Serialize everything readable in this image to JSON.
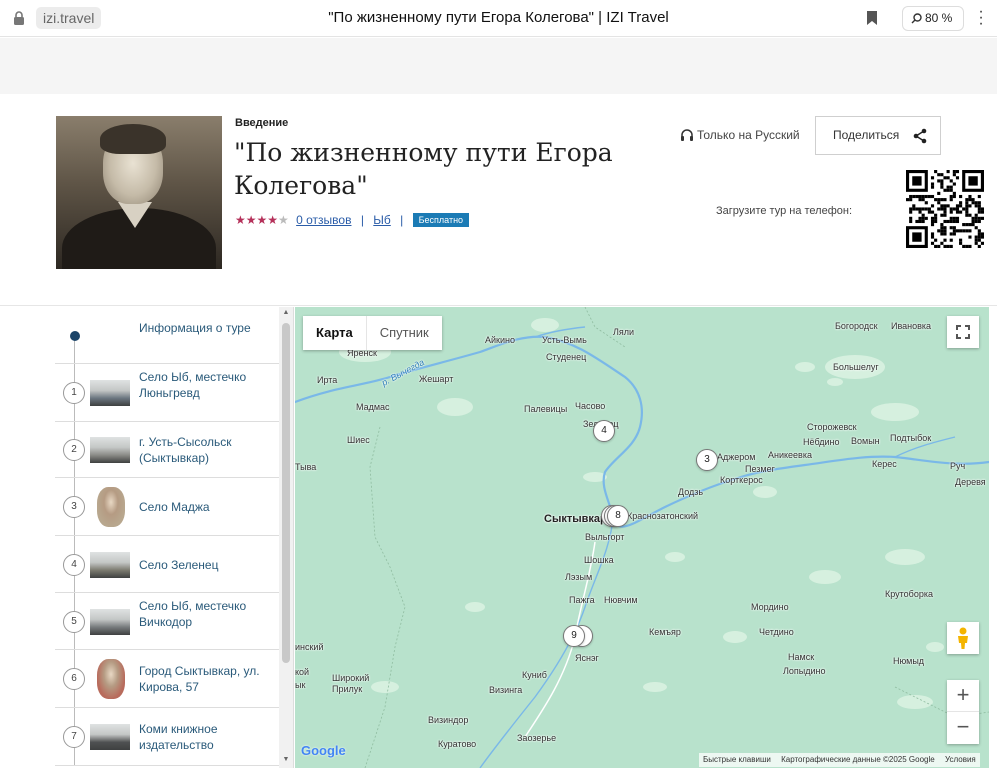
{
  "browser": {
    "domain": "izi.travel",
    "page_title": "\"По жизненному пути Егора Колегова\" | IZI Travel",
    "zoom": "80 %"
  },
  "tour": {
    "section_label": "Введение",
    "title": "\"По жизненному пути Егора Колегова\"",
    "rating": 4,
    "rating_max": 5,
    "reviews_link": "0 отзывов",
    "separator": "|",
    "location_link": "Ыб",
    "price_badge": "Бесплатно",
    "language": "Только на Русский",
    "share_label": "Поделиться",
    "download_label": "Загрузите тур на телефон:"
  },
  "colors": {
    "accent": "#1b7bb5",
    "stars": "#b5315a",
    "link": "#2a5ca8",
    "map_bg": "#b8e2cc",
    "river": "#7ab8e8"
  },
  "stops": [
    {
      "num": "",
      "label": "Информация о туре",
      "icon": "info-dot"
    },
    {
      "num": "1",
      "label": "Село Ыб, местечко Люньгревд",
      "icon": "photo-thumb"
    },
    {
      "num": "2",
      "label": "г. Усть-Сысольск (Сыктывкар)",
      "icon": "photo-thumb"
    },
    {
      "num": "3",
      "label": "Село Маджа",
      "icon": "portrait-thumb"
    },
    {
      "num": "4",
      "label": "Село Зеленец",
      "icon": "photo-thumb"
    },
    {
      "num": "5",
      "label": "Село Ыб, местечко Вичкодор",
      "icon": "photo-thumb"
    },
    {
      "num": "6",
      "label": "Город Сыктывкар, ул. Кирова, 57",
      "icon": "portrait-thumb"
    },
    {
      "num": "7",
      "label": "Коми книжное издательство",
      "icon": "photo-thumb"
    }
  ],
  "map": {
    "type_map": "Карта",
    "type_satellite": "Спутник",
    "zoom_in": "+",
    "zoom_out": "−",
    "google": "Google",
    "attrib_shortcuts": "Быстрые клавиши",
    "attrib_data": "Картографические данные ©2025 Google",
    "attrib_terms": "Условия",
    "places": {
      "ainio": "Айкино",
      "ustvym": "Усть-Вымь",
      "lyali": "Ляли",
      "studenets": "Студенец",
      "yarensk": "Яренск",
      "irta": "Ирта",
      "zheshart": "Жешарт",
      "madmas": "Мадмас",
      "chasovo": "Часово",
      "palevitsy": "Палевицы",
      "zelenets": "Зеленец",
      "shies": "Шиес",
      "tyva": "Тыва",
      "adzherom": "Аджером",
      "anikeevka": "Аникеевка",
      "pezmeg": "Пезмег",
      "korkeros": "Корткерос",
      "dodz": "Додзь",
      "syktyvkar": "Сыктывкар",
      "vylgort": "Выльгорт",
      "krasnozatonsky": "Краснозатонский",
      "shoshka": "Шошка",
      "lyzym": "Лэзым",
      "pazhga": "Пажга",
      "nyuvchim": "Нювчим",
      "kemyar": "Кемъяр",
      "yasnag": "Яснэг",
      "kunib": "Куниб",
      "vizinga": "Визинга",
      "vizindor": "Визиндор",
      "zaozerye": "Заозерье",
      "kuratovo": "Куратово",
      "shirokiy": "Широкий Прилук",
      "bogorodsk": "Богородск",
      "ivanovka": "Ивановка",
      "bolshelug": "Большелуг",
      "storozhevsk": "Сторожевск",
      "nebdino": "Нёбдино",
      "vomyn": "Вомын",
      "podtybok": "Подтыбок",
      "keres": "Керес",
      "ruch": "Руч",
      "derevya": "Деревя",
      "krutoborka": "Крутоборка",
      "mordino": "Мордино",
      "chetdino": "Четдино",
      "namsk": "Намск",
      "lopydino": "Лопыдино",
      "nyumyd": "Нюмыд",
      "vychegda": "р. Вычегда",
      "edge_insky": "инский",
      "edge_koy": "кой",
      "edge_yk": "ык"
    },
    "markers": [
      {
        "num": "4"
      },
      {
        "num": "3"
      },
      {
        "num": "8"
      },
      {
        "num": "9"
      }
    ]
  }
}
